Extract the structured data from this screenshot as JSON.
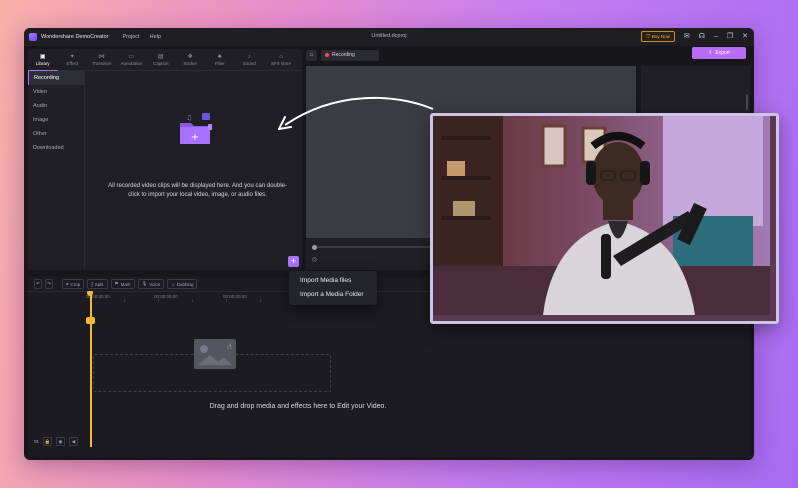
{
  "app": {
    "name": "Wondershare DemoCreator",
    "menu": [
      "Project",
      "Help"
    ],
    "document_title": "Untitled.dcproj",
    "buy_now": "Buy Now"
  },
  "library": {
    "tabs": [
      {
        "label": "Library",
        "icon": "library-icon"
      },
      {
        "label": "Effect",
        "icon": "effect-icon"
      },
      {
        "label": "Transition",
        "icon": "transition-icon"
      },
      {
        "label": "Annotation",
        "icon": "annotation-icon"
      },
      {
        "label": "Caption",
        "icon": "caption-icon"
      },
      {
        "label": "Sticker",
        "icon": "sticker-icon"
      },
      {
        "label": "Filter",
        "icon": "filter-icon"
      },
      {
        "label": "Sound",
        "icon": "sound-icon"
      },
      {
        "label": "SFX store",
        "icon": "store-icon"
      }
    ],
    "sidebar": [
      "Recording",
      "Video",
      "Audio",
      "Image",
      "Other",
      "Downloaded"
    ],
    "empty_text": "All recorded video clips will be displayed here. And you can double-click to import your local video, image, or audio files."
  },
  "preview": {
    "recording_tab": "Recording",
    "export_label": "Export"
  },
  "timeline": {
    "tools": [
      "Crop",
      "Split",
      "Mark",
      "Voice",
      "Dubbing"
    ],
    "ruler": [
      "00:00:00:00",
      "00:00:00:00",
      "00:00:00:00"
    ],
    "drop_text": "Drag and drop media and effects here to Edit your Video.",
    "track_label": "01"
  },
  "context_menu": [
    "Import Media files",
    "Import a Media Folder"
  ],
  "colors": {
    "accent": "#a971ff",
    "export": "#b86cf5",
    "playhead": "#f5b82e"
  }
}
